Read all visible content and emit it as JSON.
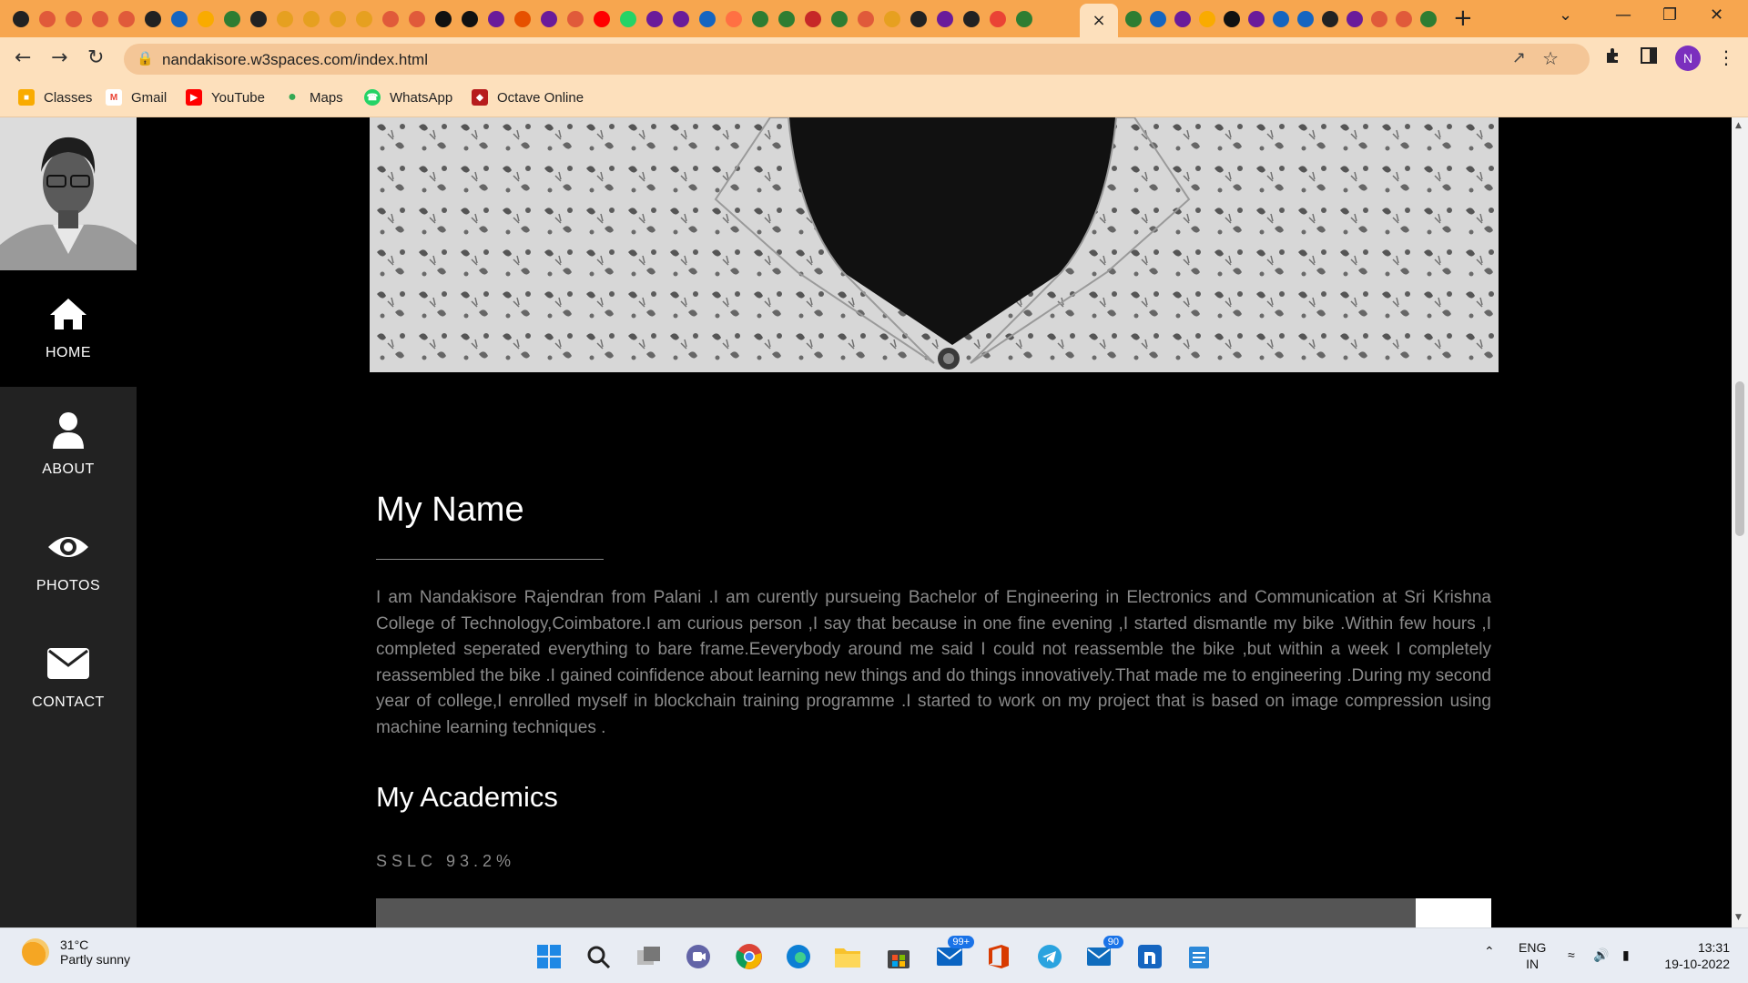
{
  "browser": {
    "url": "nandakisore.w3spaces.com/index.html",
    "profile_initial": "N",
    "active_tab_close": "×",
    "new_tab": "+",
    "bookmarks": [
      {
        "label": "Classes",
        "icon": "classroom-icon",
        "color": "#f9ab00"
      },
      {
        "label": "Gmail",
        "icon": "gmail-icon",
        "color": "#ea4335"
      },
      {
        "label": "YouTube",
        "icon": "youtube-icon",
        "color": "#ff0000"
      },
      {
        "label": "Maps",
        "icon": "maps-pin-icon",
        "color": "#34a853"
      },
      {
        "label": "WhatsApp",
        "icon": "whatsapp-icon",
        "color": "#25d366"
      },
      {
        "label": "Octave Online",
        "icon": "octave-icon",
        "color": "#b71c1c"
      }
    ]
  },
  "sidebar": {
    "items": [
      {
        "label": "HOME",
        "icon": "home-icon",
        "active": true
      },
      {
        "label": "ABOUT",
        "icon": "user-icon",
        "active": false
      },
      {
        "label": "PHOTOS",
        "icon": "eye-icon",
        "active": false
      },
      {
        "label": "CONTACT",
        "icon": "envelope-icon",
        "active": false
      }
    ]
  },
  "main": {
    "name_heading": "My Name",
    "bio": "I am Nandakisore Rajendran from Palani .I am curently pursueing Bachelor of Engineering in Electronics and Communication at Sri Krishna College of Technology,Coimbatore.I am curious person ,I say that because in one fine  evening ,I started  dismantle my bike .Within few hours ,I completed seperated everything to bare frame.Eeverybody around me said I could not reassemble the bike ,but within a week I completely reassembled the bike .I gained coinfidence about learning new things and do things innovatively.That made me to engineering .During my second year of college,I enrolled myself in blockchain training programme .I started to work on my project that is based on image compression using machine learning techniques .",
    "academics_heading": "My Academics",
    "skills": [
      {
        "label": "SSLC 93.2%",
        "percent": 93.2
      }
    ]
  },
  "taskbar": {
    "weather_temp": "31°C",
    "weather_desc": "Partly sunny",
    "mail_badge": "99+",
    "teams_badge": "90",
    "language": "ENG",
    "region": "IN",
    "time": "13:31",
    "date": "19-10-2022"
  }
}
